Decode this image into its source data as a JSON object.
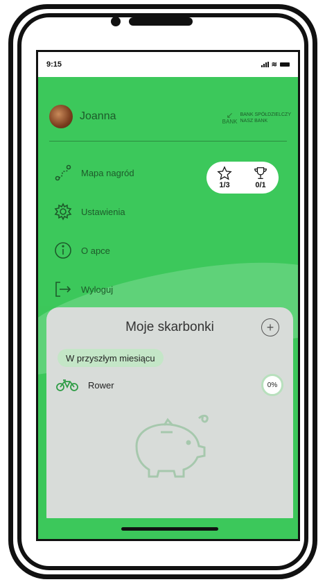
{
  "status": {
    "time": "9:15"
  },
  "user": {
    "name": "Joanna"
  },
  "bank": {
    "mark": "BANK",
    "name": "BANK SPÓŁDZIELCZY",
    "tagline": "NASZ BANK"
  },
  "menu": {
    "items": [
      {
        "label": "Mapa nagród",
        "icon": "route-icon"
      },
      {
        "label": "Ustawienia",
        "icon": "gear-icon"
      },
      {
        "label": "O apce",
        "icon": "info-icon"
      },
      {
        "label": "Wyloguj",
        "icon": "logout-icon"
      }
    ]
  },
  "badges": {
    "stars": "1/3",
    "trophies": "0/1"
  },
  "card": {
    "title": "Moje skarbonki",
    "add_label": "+",
    "section": "W przyszłym miesiącu",
    "rows": [
      {
        "label": "Rower",
        "percent": "0%"
      }
    ]
  },
  "colors": {
    "primary_green": "#3cc85b",
    "dark_green": "#1d5a2a",
    "card_bg": "#d8dcd9"
  }
}
